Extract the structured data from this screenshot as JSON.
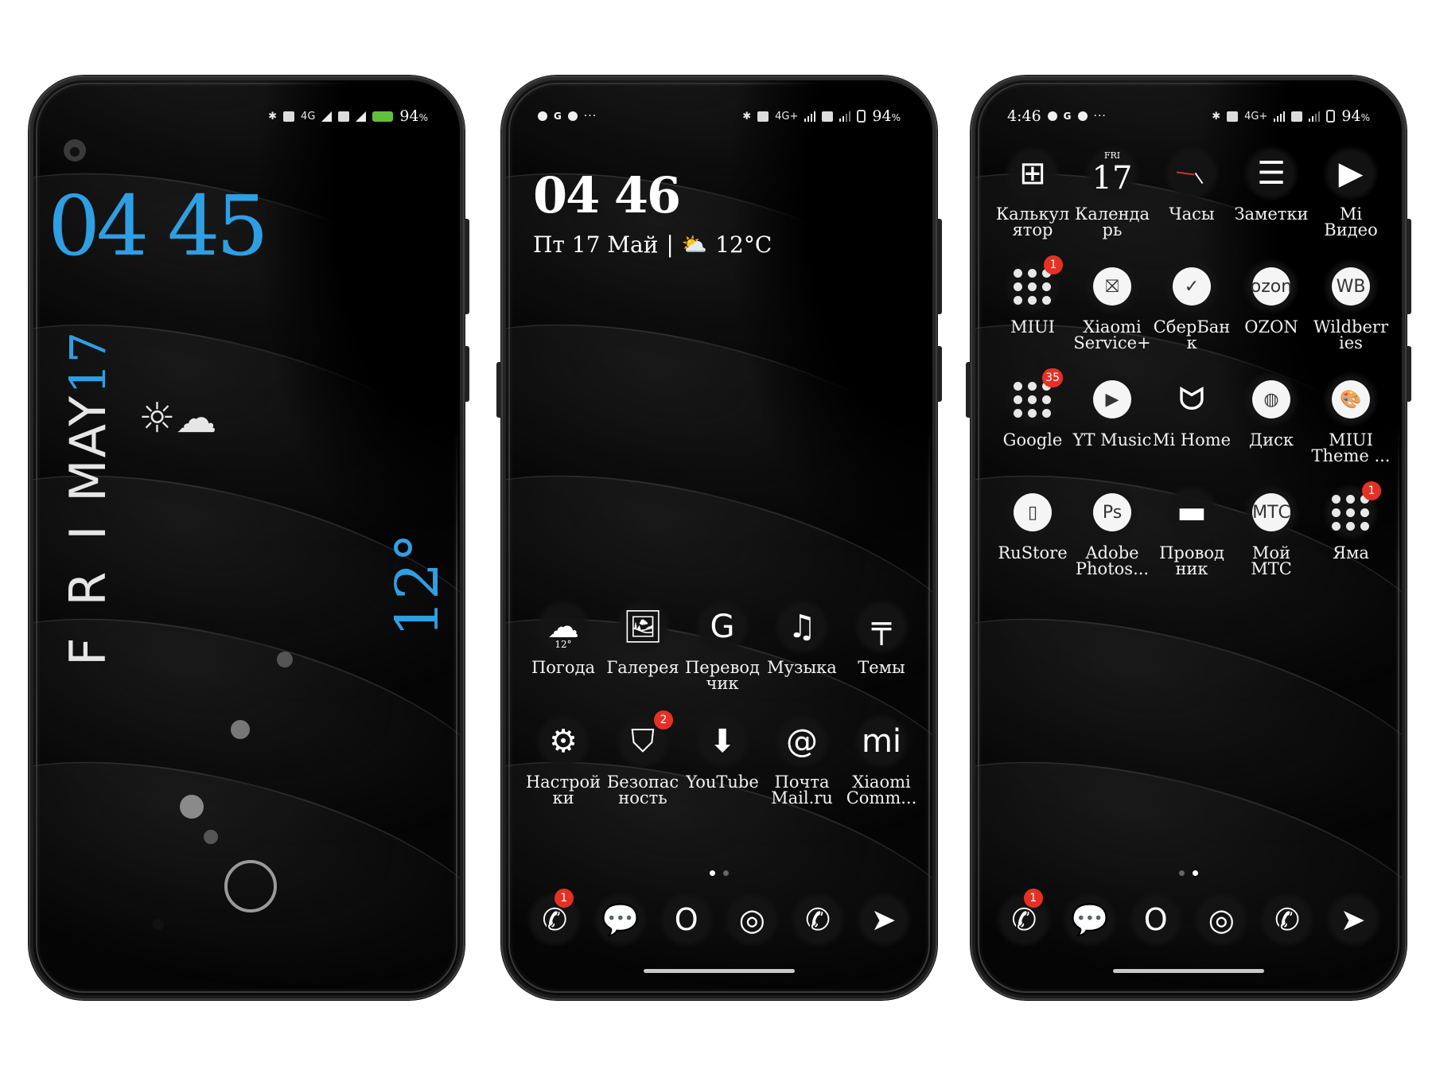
{
  "phones": [
    {
      "id": "lockscreen",
      "status_right": {
        "bluetooth": "bluetooth-icon",
        "network1": "4G",
        "battery_pct": "94",
        "pct_sign": "%"
      },
      "clock": "04 45",
      "day_abbr": "F R I",
      "month": "MAY",
      "day_num": "17",
      "weather_icon": "☼☁",
      "temperature": "12°",
      "accent_color": "#2f9fe3"
    },
    {
      "id": "home-page-1",
      "status_left": {
        "g_label": "G",
        "more": "···"
      },
      "status_right": {
        "network1": "4G+",
        "battery_pct": "94",
        "pct_sign": "%"
      },
      "clock": "04 46",
      "date": "Пт 17 Май",
      "separator": "|",
      "weather_icon": "⛅",
      "temperature": "12°C",
      "apps": [
        {
          "label": "Погода",
          "icon": "weather-icon",
          "glyph": "☁",
          "sub": "12°"
        },
        {
          "label": "Галерея",
          "icon": "gallery-icon",
          "glyph": "🖼"
        },
        {
          "label": "Перевод\nчик",
          "icon": "translate-icon",
          "glyph": "G"
        },
        {
          "label": "Музыка",
          "icon": "music-icon",
          "glyph": "♫"
        },
        {
          "label": "Темы",
          "icon": "paint-roller-icon",
          "glyph": "╤"
        },
        {
          "label": "Настрой\nки",
          "icon": "gear-icon",
          "glyph": "⚙"
        },
        {
          "label": "Безопас\nность",
          "icon": "shield-icon",
          "glyph": "⛉",
          "badge": "2"
        },
        {
          "label": "YouTube",
          "icon": "download-icon",
          "glyph": "⬇"
        },
        {
          "label": "Почта\nMail.ru",
          "icon": "mail-at-icon",
          "glyph": "@"
        },
        {
          "label": "Xiaomi\nComm...",
          "icon": "mi-bunny-icon",
          "glyph": "mi"
        }
      ],
      "pager": [
        true,
        false
      ],
      "dock": [
        {
          "icon": "phone-icon",
          "glyph": "✆",
          "badge": "1"
        },
        {
          "icon": "messages-icon",
          "glyph": "💬"
        },
        {
          "icon": "opera-icon",
          "glyph": "O"
        },
        {
          "icon": "camera-aperture-icon",
          "glyph": "◎"
        },
        {
          "icon": "whatsapp-icon",
          "glyph": "✆"
        },
        {
          "icon": "telegram-icon",
          "glyph": "➤"
        }
      ]
    },
    {
      "id": "home-page-2",
      "status_left": {
        "time": "4:46",
        "g_label": "G",
        "more": "···"
      },
      "status_right": {
        "network1": "4G+",
        "battery_pct": "94",
        "pct_sign": "%"
      },
      "apps": [
        {
          "label": "Калькул\nятор",
          "icon": "calculator-icon",
          "glyph": "⊞"
        },
        {
          "label": "Календа\nрь",
          "icon": "calendar-icon",
          "cal_day": "FRI",
          "cal_num": "17"
        },
        {
          "label": "Часы",
          "icon": "clock-icon",
          "glyph": ""
        },
        {
          "label": "Заметки",
          "icon": "notes-icon",
          "glyph": "☰"
        },
        {
          "label": "Mi\nВидео",
          "icon": "video-icon",
          "glyph": "▶"
        },
        {
          "label": "MIUI",
          "icon": "folder-icon",
          "folder": true,
          "badge": "1"
        },
        {
          "label": "Xiaomi\nService+",
          "icon": "xiaomi-service-icon",
          "disc": "⛝"
        },
        {
          "label": "СберБан\nк",
          "icon": "sberbank-icon",
          "disc": "✓"
        },
        {
          "label": "OZON",
          "icon": "ozon-icon",
          "disc": "ozon"
        },
        {
          "label": "Wildberr\nies",
          "icon": "wildberries-icon",
          "disc": "WB"
        },
        {
          "label": "Google",
          "icon": "folder-icon",
          "folder": true,
          "badge": "35"
        },
        {
          "label": "YT Music",
          "icon": "yt-music-icon",
          "disc": "▶"
        },
        {
          "label": "Mi Home",
          "icon": "mi-home-icon",
          "glyph": "ᗢ"
        },
        {
          "label": "Диск",
          "icon": "disk-icon",
          "disc": "◍"
        },
        {
          "label": "MIUI\nTheme ...",
          "icon": "palette-icon",
          "disc": "🎨"
        },
        {
          "label": "RuStore",
          "icon": "rustore-icon",
          "disc": "▯"
        },
        {
          "label": "Adobe\nPhotos...",
          "icon": "photoshop-icon",
          "disc": "Ps"
        },
        {
          "label": "Провод\nник",
          "icon": "folder-file-icon",
          "glyph": "▬"
        },
        {
          "label": "Мой\nМТС",
          "icon": "mts-icon",
          "disc": "МТС"
        },
        {
          "label": "Яма",
          "icon": "folder-icon",
          "folder": true,
          "badge": "1"
        }
      ],
      "pager": [
        false,
        true
      ],
      "dock": [
        {
          "icon": "phone-icon",
          "glyph": "✆",
          "badge": "1"
        },
        {
          "icon": "messages-icon",
          "glyph": "💬"
        },
        {
          "icon": "opera-icon",
          "glyph": "O"
        },
        {
          "icon": "camera-aperture-icon",
          "glyph": "◎"
        },
        {
          "icon": "whatsapp-icon",
          "glyph": "✆"
        },
        {
          "icon": "telegram-icon",
          "glyph": "➤"
        }
      ]
    }
  ]
}
